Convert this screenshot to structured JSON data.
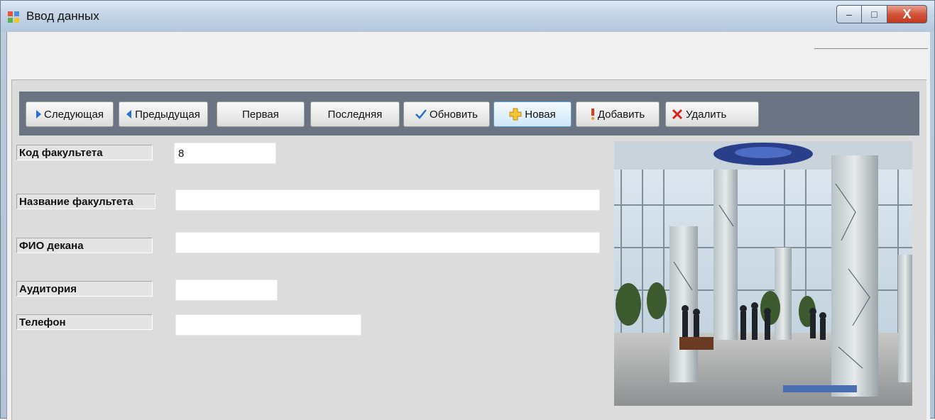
{
  "window": {
    "title": "Ввод данных",
    "controls": {
      "minimize": "–",
      "maximize": "□",
      "close": "X"
    }
  },
  "toolbar": {
    "next": "Следующая",
    "previous": "Предыдущая",
    "first": "Первая",
    "last": "Последняя",
    "refresh": "Обновить",
    "new": "Новая",
    "add": "Добавить",
    "delete": "Удалить"
  },
  "form": {
    "faculty_code": {
      "label": "Код факультета",
      "value": "8"
    },
    "faculty_name": {
      "label": "Название факультета",
      "value": ""
    },
    "dean_name": {
      "label": "ФИО декана",
      "value": ""
    },
    "room": {
      "label": "Аудитория",
      "value": ""
    },
    "phone": {
      "label": "Телефон",
      "value": ""
    }
  },
  "photo": {
    "icon": "building-lobby-photo"
  }
}
